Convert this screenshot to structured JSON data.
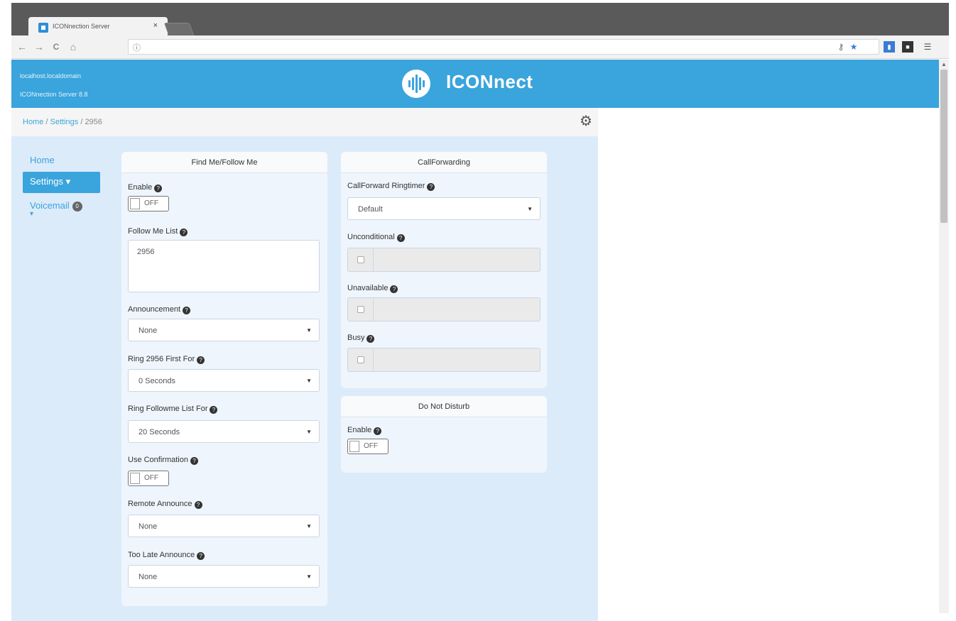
{
  "browser": {
    "tab_title": "ICONnection Server",
    "tab_close": "×",
    "url": "",
    "nav": {
      "back": "←",
      "forward": "→",
      "reload": "C",
      "home": "⌂",
      "info": "ⓘ"
    }
  },
  "header": {
    "host": "localhost.localdomain",
    "server": "ICONnection Server 8.8",
    "brand": "ICONnect",
    "brand_color": "#3aa4dc"
  },
  "breadcrumb": {
    "home": "Home",
    "sep1": " / ",
    "settings": "Settings",
    "sep2": " / ",
    "current": "2956"
  },
  "sidebar": {
    "home": "Home",
    "settings": "Settings ▾",
    "voicemail": "Voicemail",
    "voicemail_badge": "0",
    "voicemail_caret": "▾"
  },
  "find_me": {
    "title": "Find Me/Follow Me",
    "enable_label": "Enable",
    "enable_value": "OFF",
    "list_label": "Follow Me List",
    "list_value": "2956",
    "announcement_label": "Announcement",
    "announcement_value": "None",
    "ring_first_label": "Ring 2956 First For",
    "ring_first_value": "0 Seconds",
    "ring_list_label": "Ring Followme List For",
    "ring_list_value": "20 Seconds",
    "confirm_label": "Use Confirmation",
    "confirm_value": "OFF",
    "remote_label": "Remote Announce",
    "remote_value": "None",
    "toolate_label": "Too Late Announce",
    "toolate_value": "None"
  },
  "call_forwarding": {
    "title": "CallForwarding",
    "ringtimer_label": "CallForward Ringtimer",
    "ringtimer_value": "Default",
    "unconditional_label": "Unconditional",
    "unavailable_label": "Unavailable",
    "busy_label": "Busy"
  },
  "dnd": {
    "title": "Do Not Disturb",
    "enable_label": "Enable",
    "enable_value": "OFF"
  },
  "icons": {
    "help": "?",
    "caret": "▼",
    "gear": "⚙"
  }
}
